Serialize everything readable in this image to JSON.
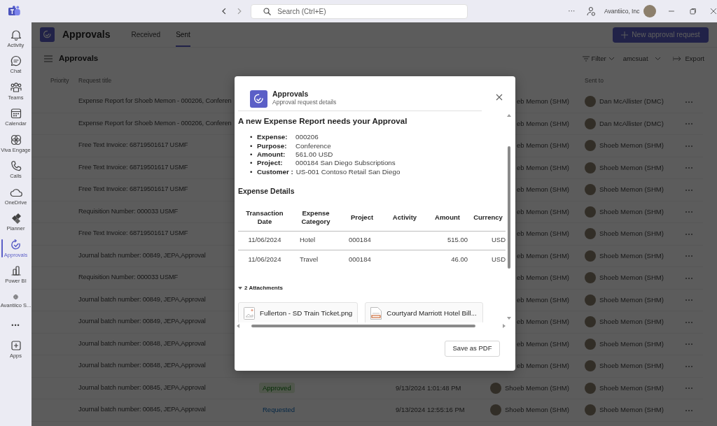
{
  "title_bar": {
    "search": {
      "placeholder": "Search (Ctrl+E)"
    },
    "more": "···",
    "org": "Avantiico, Inc"
  },
  "rail": [
    {
      "label": "Activity",
      "selected": false
    },
    {
      "label": "Chat",
      "selected": false
    },
    {
      "label": "Teams",
      "selected": false
    },
    {
      "label": "Calendar",
      "selected": false
    },
    {
      "label": "Viva Engage",
      "selected": false
    },
    {
      "label": "Calls",
      "selected": false
    },
    {
      "label": "OneDrive",
      "selected": false
    },
    {
      "label": "Planner",
      "selected": false
    },
    {
      "label": "Approvals",
      "selected": true
    },
    {
      "label": "Power BI",
      "selected": false
    },
    {
      "label": "Avantiico S...",
      "selected": false
    }
  ],
  "rail_more": "•••",
  "rail_apps": "Apps",
  "app": {
    "title": "Approvals",
    "tabs": [
      {
        "label": "Received",
        "selected": false
      },
      {
        "label": "Sent",
        "selected": true
      }
    ],
    "new_button": "New approval request",
    "subtitle": "Approvals",
    "filter": "Filter",
    "environment": "amcsuat",
    "export": "Export"
  },
  "table": {
    "columns": {
      "priority": "Priority",
      "title": "Request title",
      "sent_to": "Sent to"
    },
    "rows": [
      {
        "kind": "covered",
        "title": "Expense Report for Shoeb Memon - 000206, Conferen",
        "requested_by": "eb Memon (SHM)",
        "sent_to": "Dan McAllister (DMC)"
      },
      {
        "kind": "covered",
        "title": "Expense Report for Shoeb Memon - 000206, Conferen",
        "requested_by": "eb Memon (SHM)",
        "sent_to": "Dan McAllister (DMC)"
      },
      {
        "kind": "covered",
        "title": "Free Text Invoice: 68719501617 USMF",
        "requested_by": "eb Memon (SHM)",
        "sent_to": "Shoeb Memon (SHM)"
      },
      {
        "kind": "covered",
        "title": "Free Text Invoice: 68719501617 USMF",
        "requested_by": "eb Memon (SHM)",
        "sent_to": "Shoeb Memon (SHM)"
      },
      {
        "kind": "covered",
        "title": "Free Text Invoice: 68719501617 USMF",
        "requested_by": "eb Memon (SHM)",
        "sent_to": "Shoeb Memon (SHM)"
      },
      {
        "kind": "covered",
        "title": "Requisition Number: 000033 USMF",
        "requested_by": "eb Memon (SHM)",
        "sent_to": "Shoeb Memon (SHM)"
      },
      {
        "kind": "covered",
        "title": "Free Text Invoice: 68719501617 USMF",
        "requested_by": "eb Memon (SHM)",
        "sent_to": "Shoeb Memon (SHM)"
      },
      {
        "kind": "covered",
        "title": "Journal batch number: 00849, JEPA,Approval",
        "requested_by": "eb Memon (SHM)",
        "sent_to": "Shoeb Memon (SHM)"
      },
      {
        "kind": "covered",
        "title": "Requisition Number: 000033 USMF",
        "requested_by": "eb Memon (SHM)",
        "sent_to": "Shoeb Memon (SHM)"
      },
      {
        "kind": "covered",
        "title": "Journal batch number: 00849, JEPA,Approval",
        "requested_by": "eb Memon (SHM)",
        "sent_to": "Shoeb Memon (SHM)"
      },
      {
        "kind": "covered",
        "title": "Journal batch number: 00849, JEPA,Approval",
        "requested_by": "eb Memon (SHM)",
        "sent_to": "Shoeb Memon (SHM)"
      },
      {
        "kind": "covered",
        "title": "Journal batch number: 00848, JEPA,Approval",
        "requested_by": "eb Memon (SHM)",
        "sent_to": "Shoeb Memon (SHM)"
      },
      {
        "kind": "covered",
        "title": "Journal batch number: 00848, JEPA,Approval",
        "requested_by": "eb Memon (SHM)",
        "sent_to": "Shoeb Memon (SHM)"
      },
      {
        "kind": "full",
        "title": "Journal batch number: 00845, JEPA,Approval",
        "status": {
          "label": "Approved",
          "kind": "approved"
        },
        "date": "9/13/2024 1:01:48 PM",
        "requested_by": "Shoeb Memon (SHM)",
        "sent_to": "Shoeb Memon (SHM)"
      },
      {
        "kind": "full",
        "title": "Journal batch number: 00845, JEPA,Approval",
        "status": {
          "label": "Requested",
          "kind": "requested"
        },
        "date": "9/13/2024 12:55:16 PM",
        "requested_by": "Shoeb Memon (SHM)",
        "sent_to": "Shoeb Memon (SHM)"
      }
    ]
  },
  "dialog": {
    "app_name": "Approvals",
    "subtitle": "Approval request details",
    "heading": "A new Expense Report needs your Approval",
    "fields": [
      {
        "marker": "•",
        "label": "Expense:",
        "value": "000206"
      },
      {
        "marker": "•",
        "label": "Purpose:",
        "value": "Conference"
      },
      {
        "marker": "•",
        "label": "Amount:",
        "value": "561.00 USD"
      },
      {
        "marker": "•",
        "label": "Project:",
        "value": "000184 San Diego Subscriptions"
      },
      {
        "marker": "•",
        "label": "Customer :",
        "value": "US-001 Contoso Retail San Diego"
      }
    ],
    "details_heading": "Expense Details",
    "columns": [
      "Transaction Date",
      "Expense Category",
      "Project",
      "Activity",
      "Amount",
      "Currency"
    ],
    "rows": [
      {
        "date": "11/06/2024",
        "category": "Hotel",
        "project": "000184",
        "amount": "515.00",
        "currency": "USD"
      },
      {
        "date": "11/06/2024",
        "category": "Travel",
        "project": "000184",
        "amount": "46.00",
        "currency": "USD"
      }
    ],
    "attachments_label": "2 Attachments",
    "attachments_expanded": true,
    "attachments": [
      {
        "name": "Fullerton - SD Train Ticket.png",
        "kind": "image"
      },
      {
        "name": "Courtyard Marriott Hotel Bill...",
        "kind": "document"
      }
    ],
    "save_button": "Save as PDF"
  }
}
